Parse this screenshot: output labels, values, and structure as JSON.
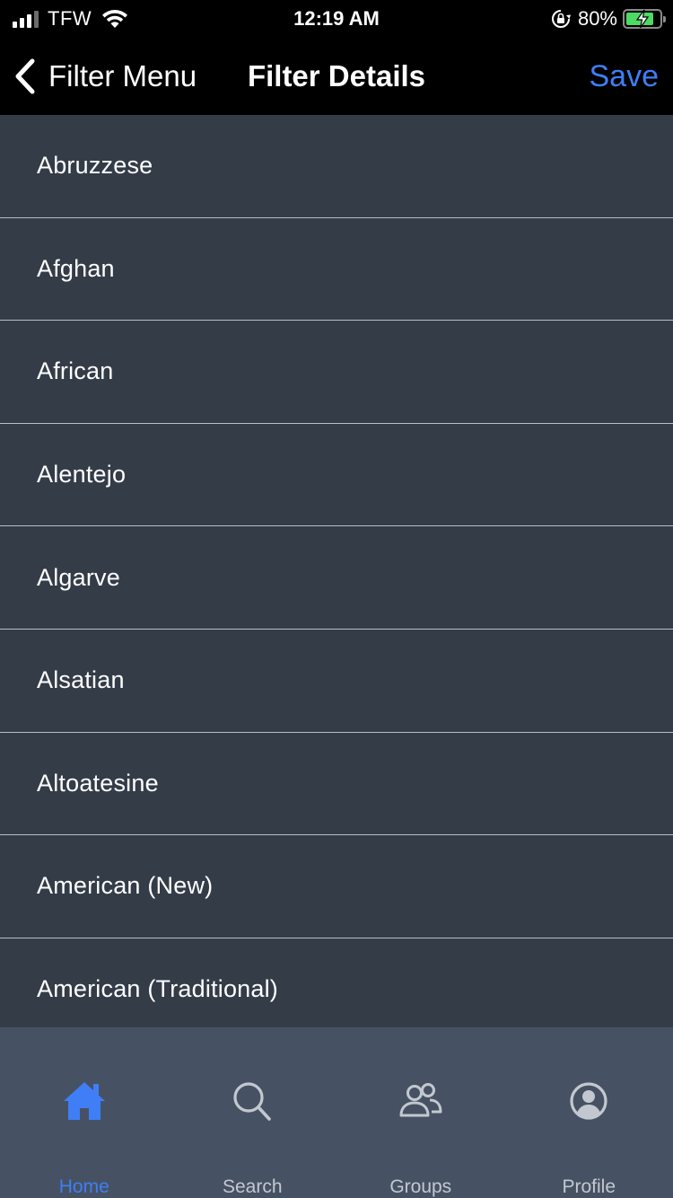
{
  "status_bar": {
    "carrier": "TFW",
    "time": "12:19 AM",
    "battery_percent": "80%",
    "battery_level": 0.8
  },
  "nav": {
    "back_label": "Filter Menu",
    "title": "Filter Details",
    "save_label": "Save"
  },
  "list": {
    "items": [
      {
        "label": "Abruzzese"
      },
      {
        "label": "Afghan"
      },
      {
        "label": "African"
      },
      {
        "label": "Alentejo"
      },
      {
        "label": "Algarve"
      },
      {
        "label": "Alsatian"
      },
      {
        "label": "Altoatesine"
      },
      {
        "label": "American (New)"
      },
      {
        "label": "American (Traditional)"
      }
    ]
  },
  "tab_bar": {
    "tabs": [
      {
        "label": "Home",
        "icon": "home-icon",
        "active": true
      },
      {
        "label": "Search",
        "icon": "search-icon",
        "active": false
      },
      {
        "label": "Groups",
        "icon": "groups-icon",
        "active": false
      },
      {
        "label": "Profile",
        "icon": "profile-icon",
        "active": false
      }
    ]
  },
  "colors": {
    "accent": "#3f7ef6",
    "list_background": "#343c48",
    "tab_bar_background": "#465263",
    "nav_background": "#000000",
    "battery_fill": "#4cd964"
  }
}
